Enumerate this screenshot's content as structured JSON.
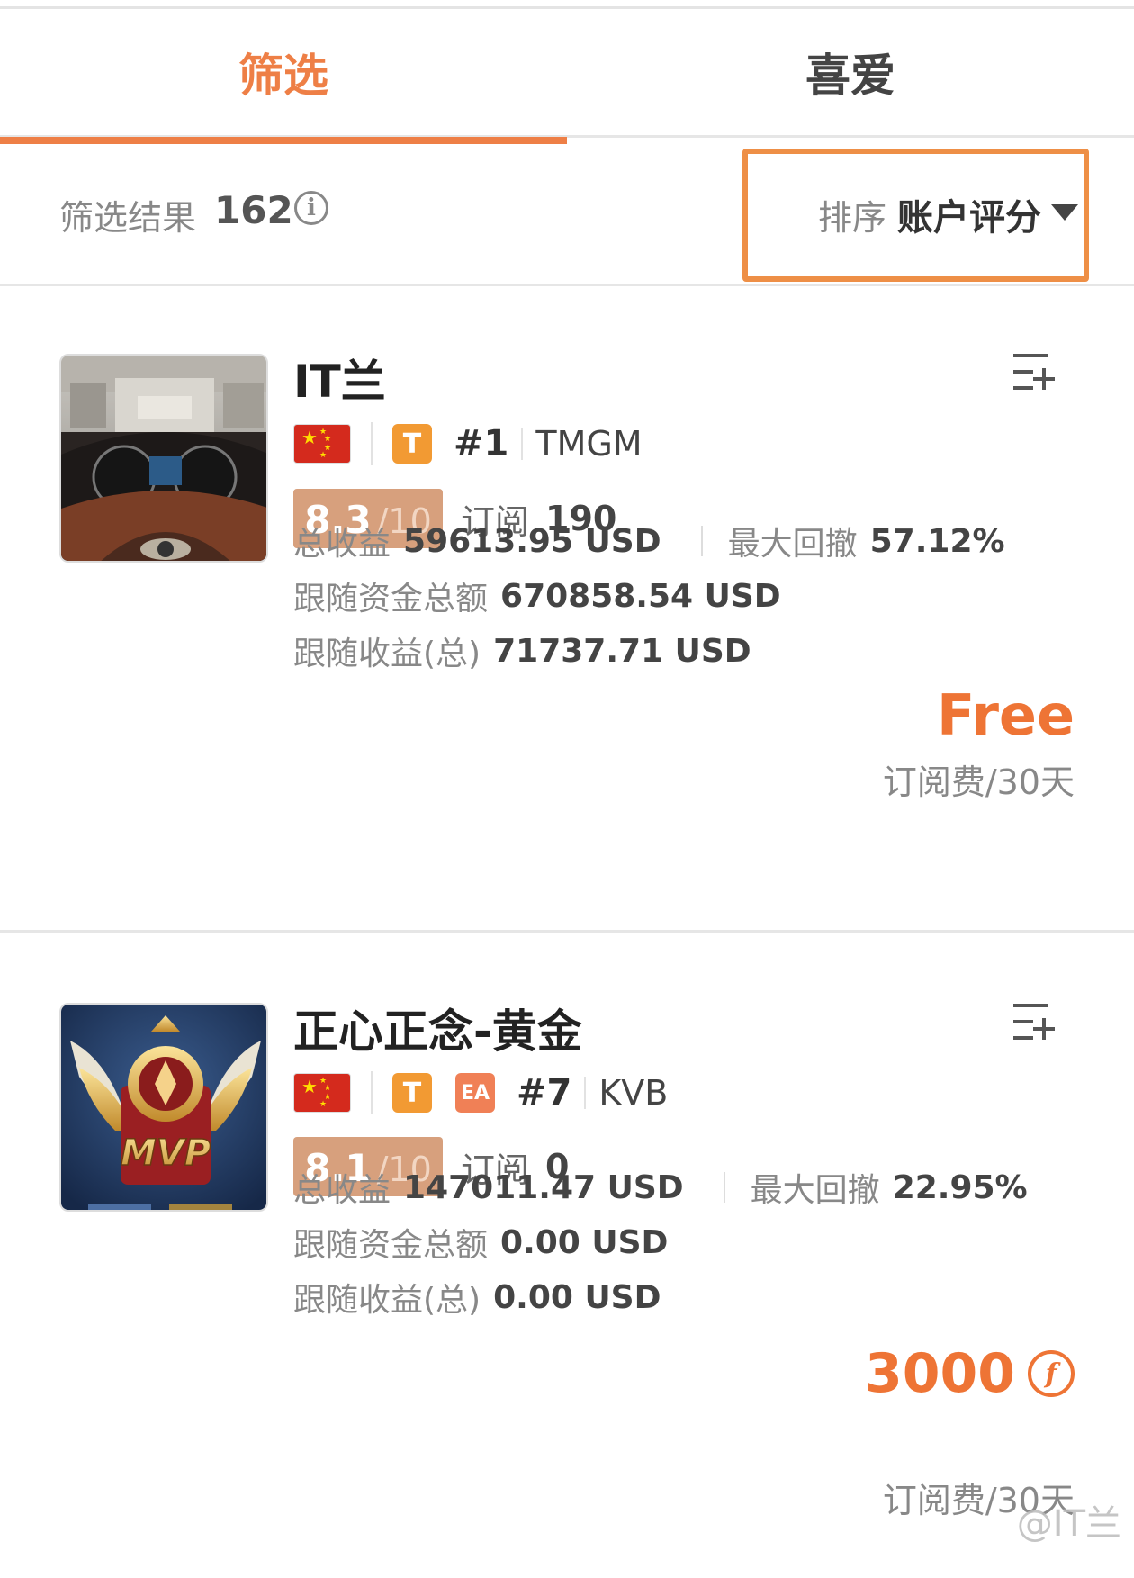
{
  "tabs": [
    {
      "label": "筛选",
      "active": true
    },
    {
      "label": "喜爱",
      "active": false
    }
  ],
  "filter_bar": {
    "result_label": "筛选结果",
    "result_count": "162",
    "info_icon": "info-icon",
    "sort_label": "排序",
    "sort_value": "账户评分"
  },
  "accent_color": "#ee7f46",
  "cards": [
    {
      "title": "IT兰",
      "avatar": "car-dashboard-photo",
      "flag": "china-flag",
      "badges": [
        "T"
      ],
      "rank": "#1",
      "broker": "TMGM",
      "score": "8.3",
      "score_max": "/10",
      "subscribe_label": "订阅",
      "subscribe_count": "190",
      "total_profit_label": "总收益",
      "total_profit": "59613.95 USD",
      "max_drawdown_label": "最大回撤",
      "max_drawdown": "57.12%",
      "follow_funds_label": "跟随资金总额",
      "follow_funds": "670858.54 USD",
      "follow_profit_label": "跟随收益(总)",
      "follow_profit": "71737.71 USD",
      "price": "Free",
      "fee_label": "订阅费/30天"
    },
    {
      "title": "正心正念-黄金",
      "avatar": "mvp-emblem-image",
      "flag": "china-flag",
      "badges": [
        "T",
        "EA"
      ],
      "rank": "#7",
      "broker": "KVB",
      "score": "8.1",
      "score_max": "/10",
      "subscribe_label": "订阅",
      "subscribe_count": "0",
      "total_profit_label": "总收益",
      "total_profit": "147011.47 USD",
      "max_drawdown_label": "最大回撤",
      "max_drawdown": "22.95%",
      "follow_funds_label": "跟随资金总额",
      "follow_funds": "0.00 USD",
      "follow_profit_label": "跟随收益(总)",
      "follow_profit": "0.00 USD",
      "price": "3000",
      "price_icon": "coin-icon",
      "fee_label": "订阅费/30天"
    }
  ],
  "watermark": "@IT兰"
}
